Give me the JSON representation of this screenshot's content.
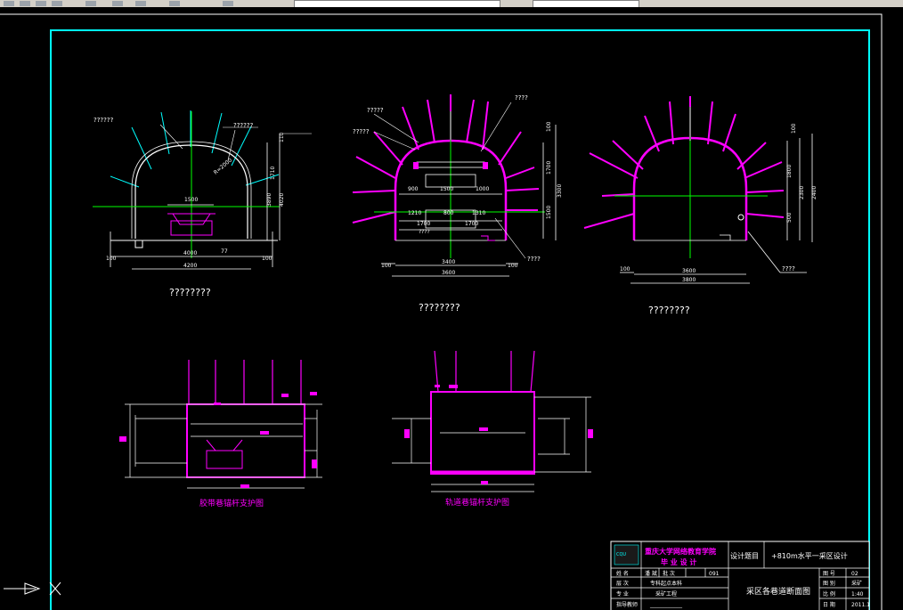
{
  "toolbar": {
    "icons": [
      "toolbar-icon",
      "toolbar-icon",
      "toolbar-icon",
      "toolbar-icon",
      "toolbar-icon",
      "toolbar-icon",
      "toolbar-icon",
      "toolbar-icon",
      "toolbar-icon"
    ]
  },
  "colors": {
    "background": "#000000",
    "frame": "#00ffff",
    "outer_frame": "#ffffff",
    "profile": "#ffffff",
    "support": "#ff00ff",
    "bolt_cyan": "#00ffff",
    "centerline": "#00ff00",
    "title_text": "#ff00ff"
  },
  "sections": {
    "left": {
      "caption": "????????",
      "callout_bolt": "??????",
      "callout_bolt2": "??????",
      "width_inner": "4000",
      "width_outer": "4200",
      "dim_100_a": "100",
      "dim_100_b": "100",
      "dim_1500": "1500",
      "dim_1710": "1710",
      "dim_3890": "3890",
      "dim_4020": "4020",
      "dim_110": "110",
      "arch_label": "R=2000"
    },
    "middle": {
      "caption": "????????",
      "callouts": [
        "????",
        "?????",
        "?????",
        "????",
        "????"
      ],
      "dims_row1": [
        "900",
        "1500",
        "1000"
      ],
      "dims_row2": [
        "1210",
        "800",
        "1310"
      ],
      "dims_row3": [
        "1700",
        "1700"
      ],
      "v_1700": "1700",
      "v_1500": "1500",
      "v_3300": "3300",
      "v_100": "100",
      "width_inner": "3400",
      "width_outer": "3600",
      "dim_100_a": "100",
      "dim_100_b": "100"
    },
    "right": {
      "caption": "????????",
      "callout": "????",
      "v_1800": "1800",
      "v_500": "500",
      "v_2300": "2300",
      "v_2400": "2400",
      "v_100": "100",
      "width_inner": "3600",
      "width_outer": "3800",
      "dim_100": "100"
    }
  },
  "plans": {
    "left_title": "胶带巷锚杆支护图",
    "right_title": "轨道巷锚杆支护图"
  },
  "title_block": {
    "school": "重庆大学网络教育学院",
    "subtitle": "毕 业 设 计",
    "design_topic_label": "设计题目",
    "design_topic": "+810m水平一采区设计",
    "drawing_title": "采区各巷道断面图",
    "rows": [
      [
        "姓 名",
        "潘 斌",
        "批 次",
        "091"
      ],
      [
        "层 次",
        "专科起点本科"
      ],
      [
        "专 业",
        "采矿工程"
      ],
      [
        "指导教师",
        "____________"
      ]
    ],
    "right_rows": [
      [
        "图 号",
        "02"
      ],
      [
        "图 别",
        "采矿"
      ],
      [
        "比 例",
        "1:40"
      ],
      [
        "日 期",
        "2011.1"
      ]
    ]
  }
}
